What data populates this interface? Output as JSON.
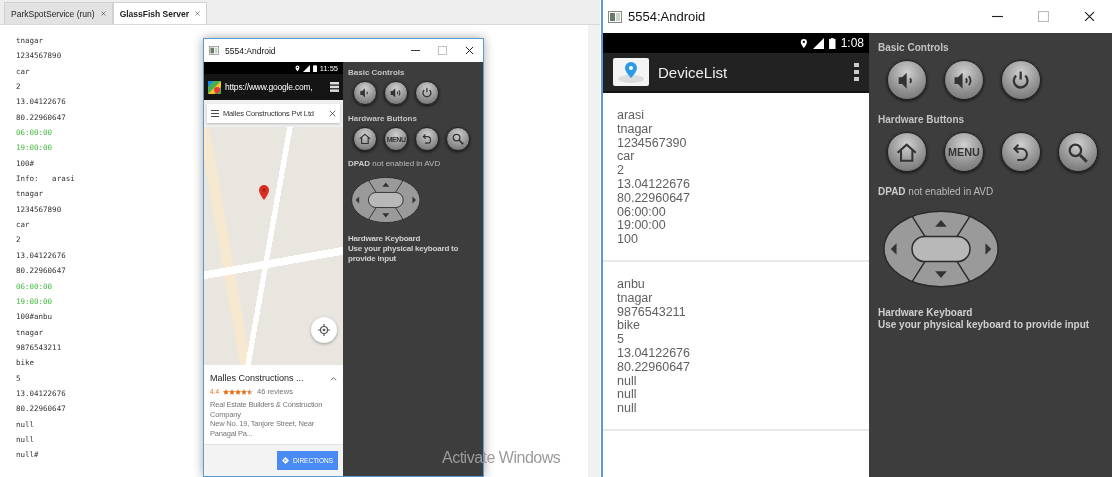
{
  "ide_output": {
    "tabs": [
      {
        "label": "ParkSpotService (run)",
        "selected": false
      },
      {
        "label": "GlassFish Server",
        "selected": true
      }
    ],
    "lines": [
      {
        "text": "tnagar",
        "kind": "plain"
      },
      {
        "text": "1234567890",
        "kind": "plain"
      },
      {
        "text": "car",
        "kind": "plain"
      },
      {
        "text": "2",
        "kind": "plain"
      },
      {
        "text": "13.04122676",
        "kind": "plain"
      },
      {
        "text": "80.22960647",
        "kind": "plain"
      },
      {
        "text": "06:00:00",
        "kind": "time"
      },
      {
        "text": "19:00:00",
        "kind": "time"
      },
      {
        "text": "100#",
        "kind": "plain"
      },
      {
        "text": "Info:   arasi",
        "kind": "plain"
      },
      {
        "text": "tnagar",
        "kind": "plain"
      },
      {
        "text": "1234567890",
        "kind": "plain"
      },
      {
        "text": "car",
        "kind": "plain"
      },
      {
        "text": "2",
        "kind": "plain"
      },
      {
        "text": "13.04122676",
        "kind": "plain"
      },
      {
        "text": "80.22960647",
        "kind": "plain"
      },
      {
        "text": "06:00:00",
        "kind": "time"
      },
      {
        "text": "19:00:00",
        "kind": "time"
      },
      {
        "text": "100#anbu",
        "kind": "plain"
      },
      {
        "text": "tnagar",
        "kind": "plain"
      },
      {
        "text": "9876543211",
        "kind": "plain"
      },
      {
        "text": "bike",
        "kind": "plain"
      },
      {
        "text": "5",
        "kind": "plain"
      },
      {
        "text": "13.04122676",
        "kind": "plain"
      },
      {
        "text": "80.22960647",
        "kind": "plain"
      },
      {
        "text": "null",
        "kind": "plain"
      },
      {
        "text": "null",
        "kind": "plain"
      },
      {
        "text": "null#",
        "kind": "plain"
      }
    ]
  },
  "small_emulator": {
    "title": "5554:Android",
    "phone": {
      "kind": "maps",
      "time": "11:55",
      "url": "https://www.google.com,",
      "search": "Malles Constructions Pvt Ltd",
      "place": {
        "name": "Malles Constructions ...",
        "rating": "4.4",
        "stars": 4.5,
        "reviews": "46 reviews",
        "description": [
          "Real Estate Builders & Construction Company",
          "New No. 19, Tanjore Street, Near Panagal Pa..."
        ]
      },
      "directions": "DIRECTIONS"
    },
    "controls": {
      "basic_label": "Basic Controls",
      "basic": [
        {
          "kind": "volume_down"
        },
        {
          "kind": "volume_up"
        },
        {
          "kind": "power"
        }
      ],
      "hardware_label": "Hardware Buttons",
      "hardware": [
        {
          "kind": "home"
        },
        {
          "kind": "menu",
          "label": "MENU"
        },
        {
          "kind": "back"
        },
        {
          "kind": "search"
        }
      ],
      "dpad_note": "**DPAD** not enabled in AVD",
      "keyboard_title": "Hardware Keyboard",
      "keyboard_note": "Use your physical keyboard to provide input"
    }
  },
  "large_emulator": {
    "title": "5554:Android",
    "phone": {
      "kind": "device_list",
      "time": "1:08",
      "app_title": "DeviceList",
      "devices": [
        {
          "lines": [
            "arasi",
            "tnagar",
            "1234567390",
            "car",
            "2",
            "13.04122676",
            "80.22960647",
            "06:00:00",
            "19:00:00",
            "100"
          ]
        },
        {
          "lines": [
            "anbu",
            "tnagar",
            "9876543211",
            "bike",
            "5",
            "13.04122676",
            "80.22960647",
            "null",
            "null",
            "null"
          ]
        }
      ]
    },
    "controls": {
      "basic_label": "Basic Controls",
      "basic": [
        {
          "kind": "volume_down"
        },
        {
          "kind": "volume_up"
        },
        {
          "kind": "power"
        }
      ],
      "hardware_label": "Hardware Buttons",
      "hardware": [
        {
          "kind": "home"
        },
        {
          "kind": "menu",
          "label": "MENU"
        },
        {
          "kind": "back"
        },
        {
          "kind": "search"
        }
      ],
      "dpad_note": "**DPAD** not enabled in AVD",
      "keyboard_title": "Hardware Keyboard",
      "keyboard_note": "Use your physical keyboard to provide input"
    }
  },
  "activation_notice": "Activate Windows"
}
